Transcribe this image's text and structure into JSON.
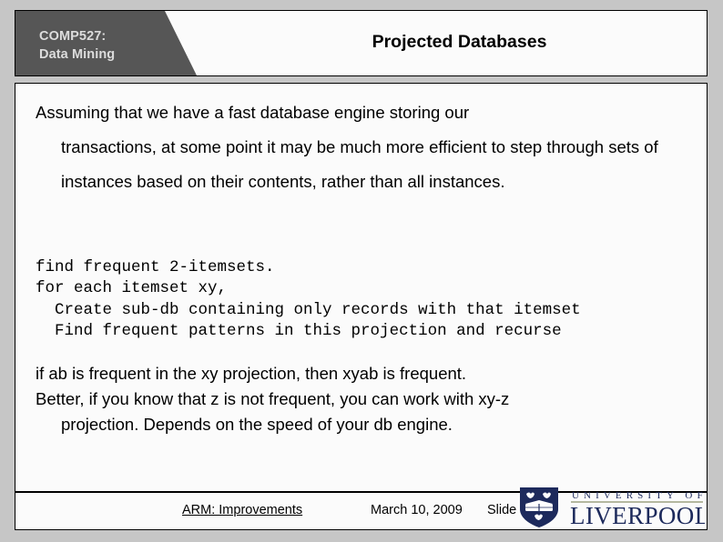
{
  "slide": {
    "header": {
      "course_line1": "COMP527:",
      "course_line2": "Data Mining",
      "course_label": "COMP527:\nData Mining",
      "title": "Projected Databases",
      "tab_color": "#565656",
      "box_bg": "#fbfbfb",
      "border_color": "#000000"
    },
    "body": {
      "paragraph_1_line1": "Assuming that we have a fast database engine storing our",
      "paragraph_1_continuation": "transactions, at some point it may be much more efficient to step through sets of instances based on their contents, rather than all instances.",
      "code_block": "find frequent 2-itemsets.\nfor each itemset xy,\n  Create sub-db containing only records with that itemset\n  Find frequent patterns in this projection and recurse",
      "paragraph_3_line1": "if ab is frequent in the xy projection, then xyab is frequent.",
      "paragraph_3_line2": "Better, if you know that z is not frequent, you can work with xy-z",
      "paragraph_3_line3": "projection.  Depends on the speed of your db engine."
    },
    "footer": {
      "link_text": "ARM: Improvements",
      "date": "March 10, 2009",
      "slide_label": "Slide",
      "logo": {
        "line1": "UNIVERSITY OF",
        "line2": "LIVERPOOL",
        "color": "#1d2a5c",
        "crest_name": "liverpool-shield-crest"
      }
    },
    "background_color": "#c6c6c6"
  }
}
